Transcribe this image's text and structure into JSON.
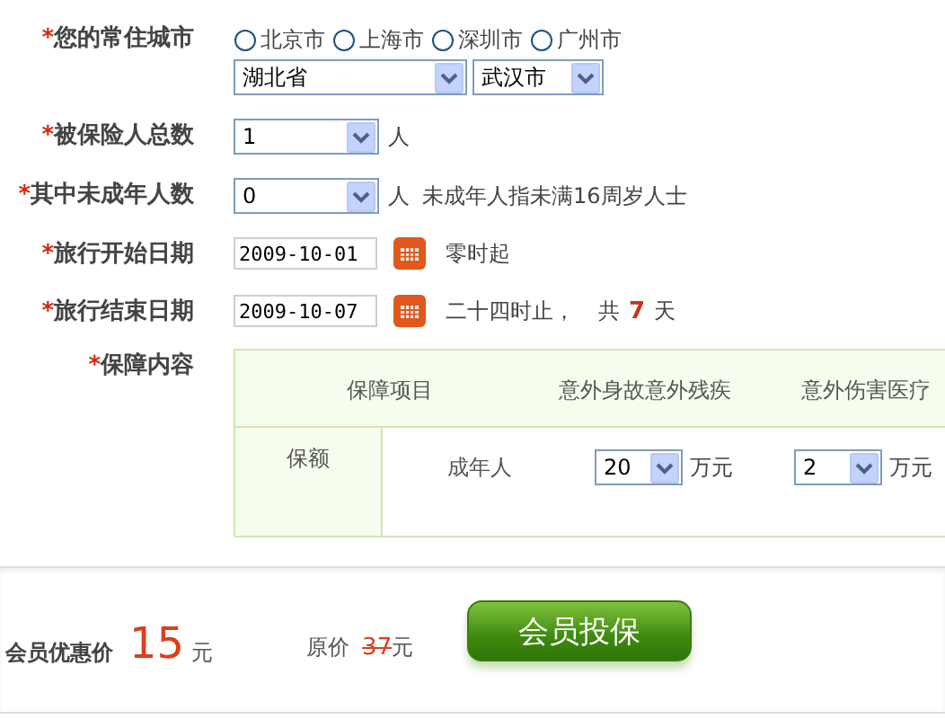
{
  "city": {
    "mark": "*",
    "label": "您的常住城市",
    "options": [
      {
        "label": "北京市",
        "selected": false
      },
      {
        "label": "上海市",
        "selected": false
      },
      {
        "label": "深圳市",
        "selected": false
      },
      {
        "label": "广州市",
        "selected": false
      }
    ],
    "province": "湖北省",
    "city": "武汉市"
  },
  "insured_total": {
    "mark": "*",
    "label": "被保险人总数",
    "value": "1",
    "unit": "人"
  },
  "minors": {
    "mark": "*",
    "label": "其中未成年人数",
    "value": "0",
    "unit": "人",
    "note": "未成年人指未满16周岁人士"
  },
  "start_date": {
    "mark": "*",
    "label": "旅行开始日期",
    "value": "2009-10-01",
    "note": "零时起"
  },
  "end_date": {
    "mark": "*",
    "label": "旅行结束日期",
    "value": "2009-10-07",
    "note": "二十四时止，",
    "total_prefix": "共",
    "days": "7",
    "days_unit": "天"
  },
  "coverage": {
    "mark": "*",
    "label": "保障内容",
    "columns": [
      "保障项目",
      "意外身故意外残疾",
      "意外伤害医疗"
    ],
    "row_header": "保额",
    "rows": [
      {
        "group": "成年人",
        "amounts": [
          {
            "value": "20",
            "unit": "万元"
          },
          {
            "value": "2",
            "unit": "万元"
          }
        ]
      }
    ]
  },
  "footer": {
    "member_price_label": "会员优惠价",
    "member_price": "15",
    "member_price_unit": "元",
    "original_label": "原价",
    "original_price": "37",
    "original_unit": "元",
    "button": "会员投保"
  }
}
